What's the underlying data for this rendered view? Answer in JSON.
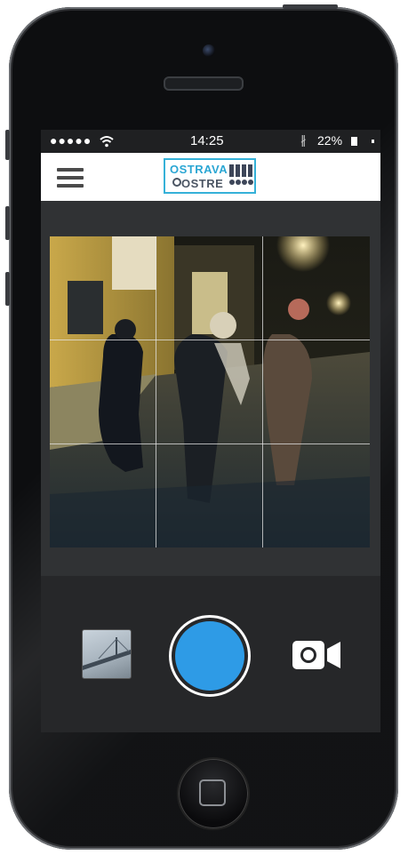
{
  "status_bar": {
    "signal": "●●●●●",
    "time": "14:25",
    "bluetooth": "∦",
    "battery": "22%"
  },
  "app_bar": {
    "logo_line1": "OSTRAVA",
    "logo_line2": "OSTRE"
  },
  "camera": {
    "grid": "3x3"
  },
  "controls": {
    "gallery_icon": "gallery-thumbnail",
    "shutter_icon": "shutter",
    "video_icon": "video-camera-icon"
  },
  "colors": {
    "accent": "#2e9be6",
    "logo_blue": "#2aa6d3"
  }
}
